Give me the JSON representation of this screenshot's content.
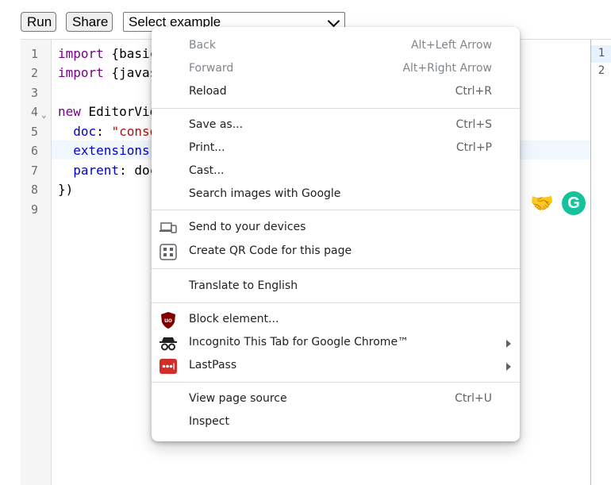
{
  "toolbar": {
    "run_label": "Run",
    "share_label": "Share",
    "select_value": "Select example"
  },
  "editor": {
    "line_numbers": [
      "1",
      "2",
      "3",
      "4",
      "5",
      "6",
      "7",
      "8",
      "9"
    ],
    "fold_marker": "⌄",
    "lines": {
      "l1_kw": "import",
      "l1_rest": " {basic",
      "l2_kw": "import",
      "l2_rest": " {javas",
      "l4_kw": "new",
      "l4_rest": " EditorVie",
      "l5_prop": "  doc",
      "l5_colon": ": ",
      "l5_str": "\"conso",
      "l6_prop": "  extensions",
      "l7_prop": "  parent",
      "l7_rest": ": doc",
      "l8": "})"
    },
    "right_line_numbers": [
      "1",
      "2"
    ]
  },
  "extensions": {
    "handshake_icon": "handshake-icon",
    "grammarly_letter": "G"
  },
  "context_menu": {
    "back": {
      "label": "Back",
      "shortcut": "Alt+Left Arrow"
    },
    "forward": {
      "label": "Forward",
      "shortcut": "Alt+Right Arrow"
    },
    "reload": {
      "label": "Reload",
      "shortcut": "Ctrl+R"
    },
    "save_as": {
      "label": "Save as...",
      "shortcut": "Ctrl+S"
    },
    "print": {
      "label": "Print...",
      "shortcut": "Ctrl+P"
    },
    "cast": {
      "label": "Cast..."
    },
    "search_images": {
      "label": "Search images with Google"
    },
    "send_devices": {
      "label": "Send to your devices"
    },
    "qr_code": {
      "label": "Create QR Code for this page"
    },
    "translate": {
      "label": "Translate to English"
    },
    "block_element": {
      "label": "Block element..."
    },
    "incognito": {
      "label": "Incognito This Tab for Google Chrome™"
    },
    "lastpass": {
      "label": "LastPass"
    },
    "view_source": {
      "label": "View page source",
      "shortcut": "Ctrl+U"
    },
    "inspect": {
      "label": "Inspect"
    }
  }
}
